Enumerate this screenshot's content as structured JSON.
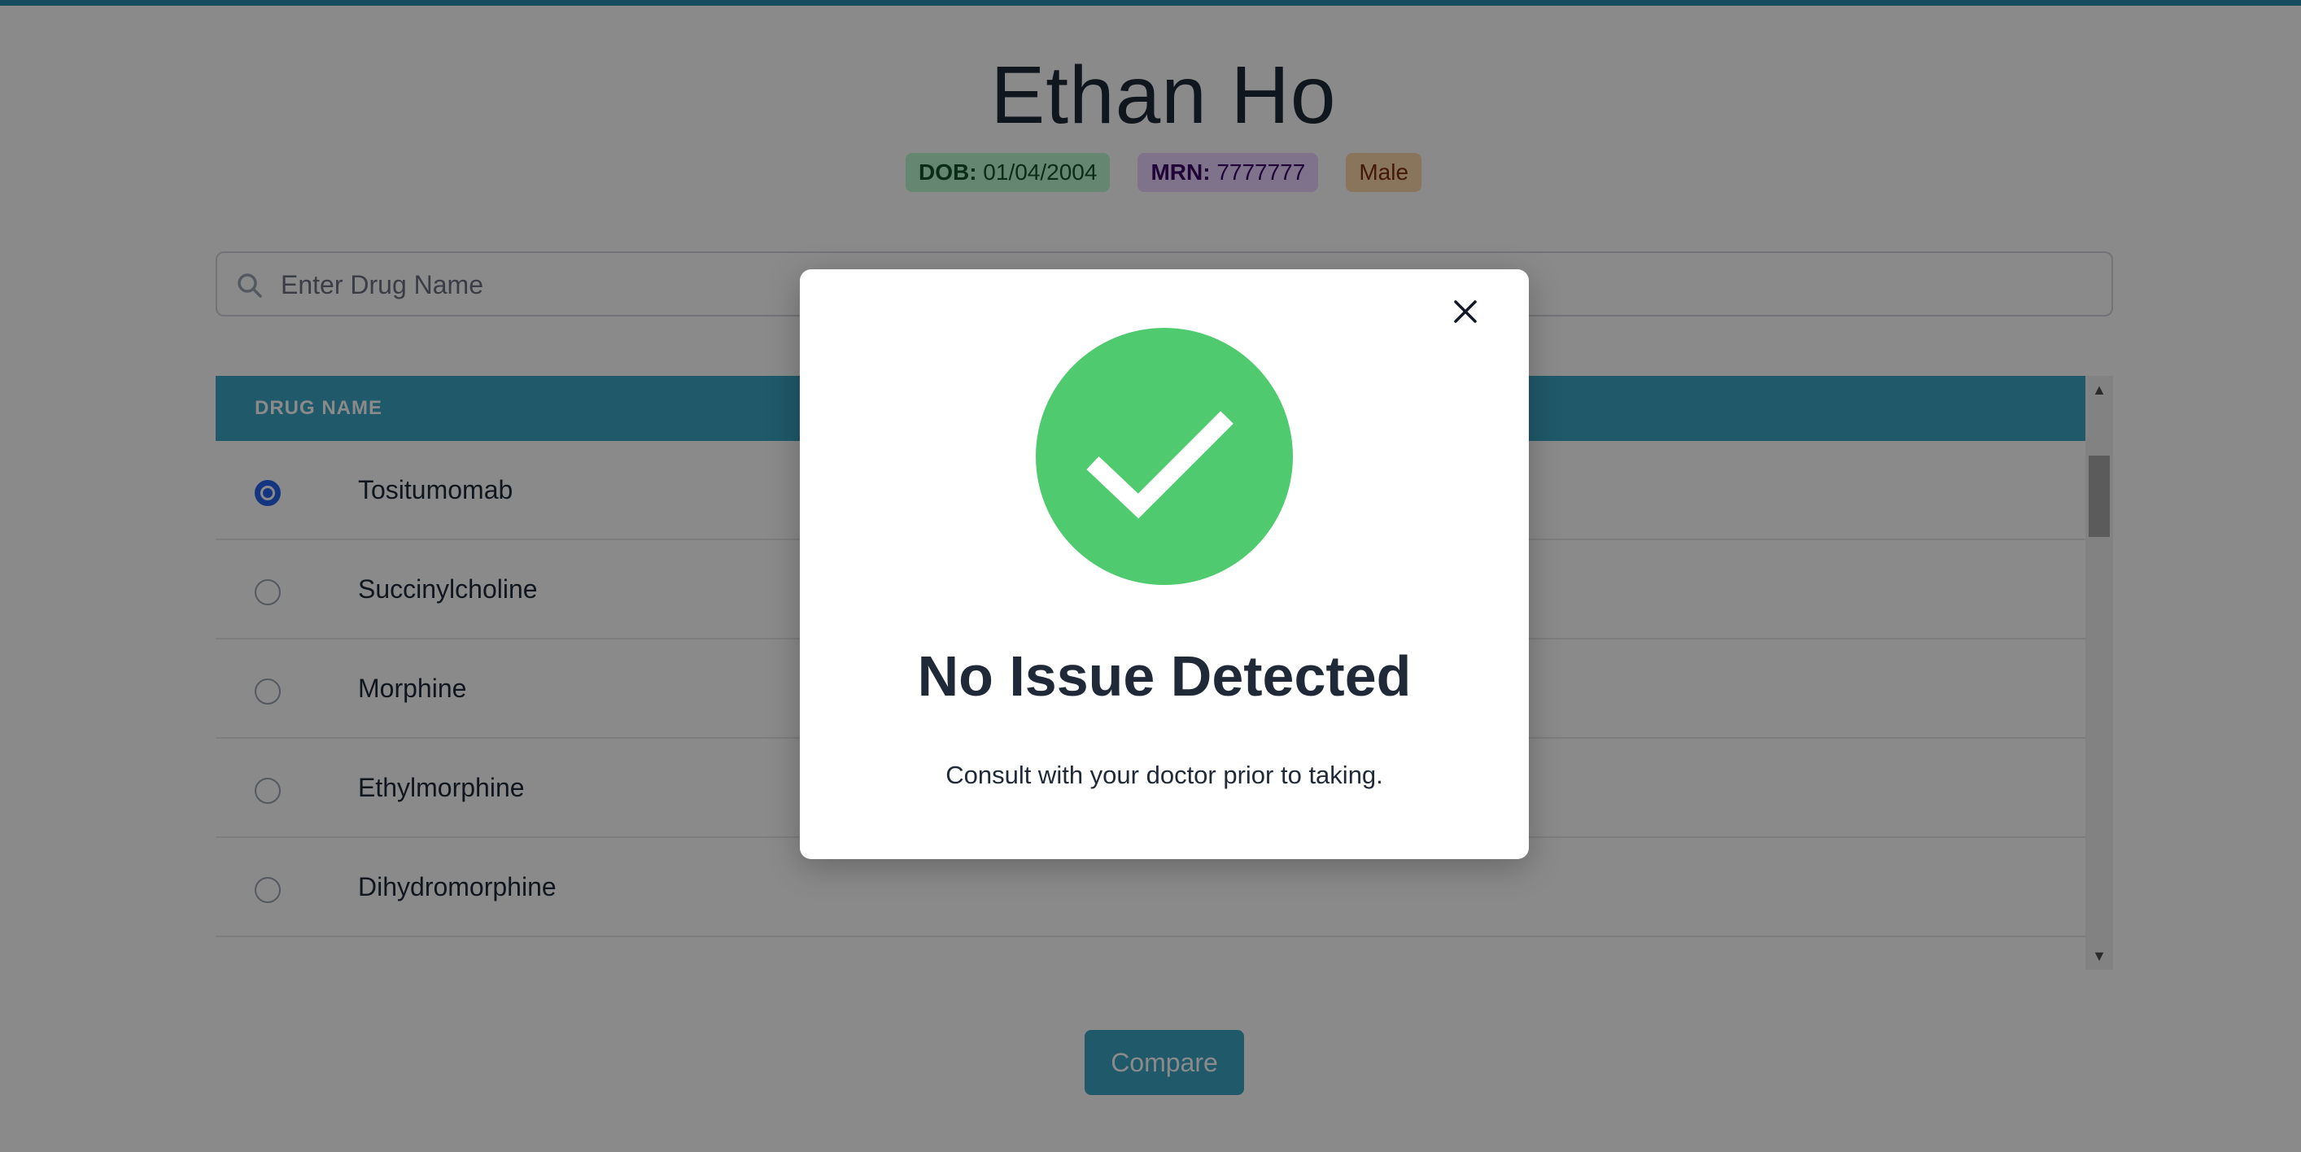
{
  "patient": {
    "name": "Ethan Ho",
    "dob_label": "DOB:",
    "dob_value": "01/04/2004",
    "mrn_label": "MRN:",
    "mrn_value": "7777777",
    "sex": "Male"
  },
  "search": {
    "placeholder": "Enter Drug Name",
    "icon": "search-icon"
  },
  "table": {
    "header": "DRUG NAME",
    "rows": [
      {
        "name": "Tositumomab",
        "selected": true
      },
      {
        "name": "Succinylcholine",
        "selected": false
      },
      {
        "name": "Morphine",
        "selected": false
      },
      {
        "name": "Ethylmorphine",
        "selected": false
      },
      {
        "name": "Dihydromorphine",
        "selected": false
      }
    ]
  },
  "compare_button": "Compare",
  "modal": {
    "title": "No Issue Detected",
    "message": "Consult with your doctor prior to taking.",
    "icon": "check-circle-icon",
    "close_icon": "close-icon"
  },
  "colors": {
    "accent": "#3aa4c4",
    "success": "#4ade80",
    "overlay": "rgba(0,0,0,0.46)"
  }
}
